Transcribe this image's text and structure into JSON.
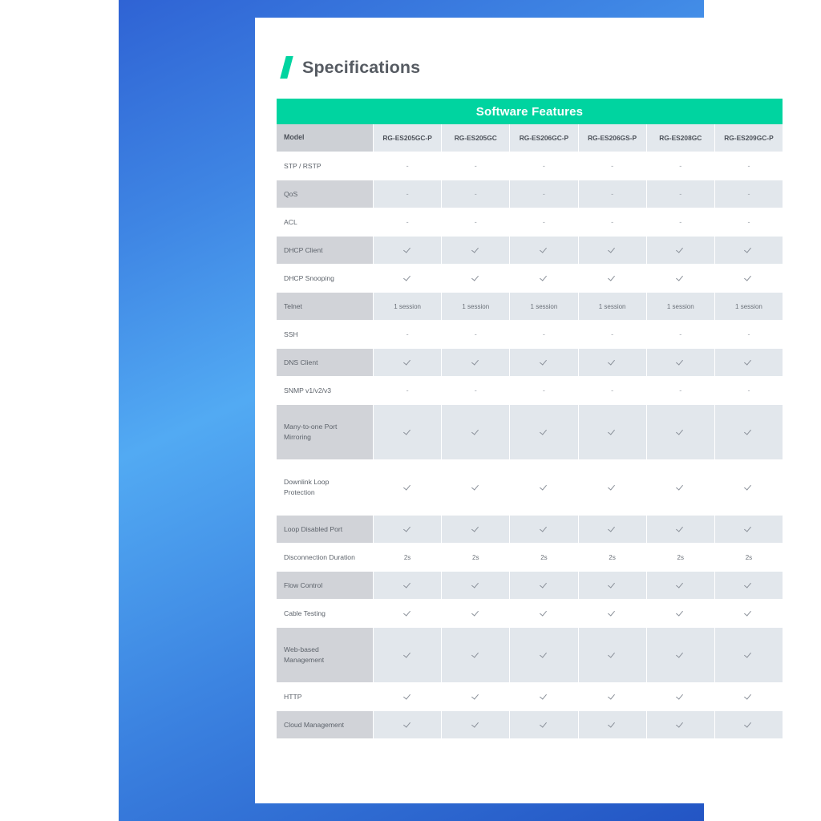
{
  "page": {
    "title": "Specifications",
    "slash_icon": "green-slash-icon",
    "accent_green": "#00d4a0",
    "frame_blue_start": "#2f63d4",
    "frame_blue_mid": "#52aaf3",
    "frame_blue_end": "#2355c4"
  },
  "table": {
    "band_title": "Software Features",
    "columns": [
      "Model",
      "RG-ES205GC-P",
      "RG-ES205GC",
      "RG-ES206GC-P",
      "RG-ES206GS-P",
      "RG-ES208GC",
      "RG-ES209GC-P"
    ],
    "rows": [
      {
        "label": "STP / RSTP",
        "lines": 1,
        "shaded": false,
        "values": [
          "-",
          "-",
          "-",
          "-",
          "-",
          "-"
        ]
      },
      {
        "label": "QoS",
        "lines": 1,
        "shaded": true,
        "values": [
          "-",
          "-",
          "-",
          "-",
          "-",
          "-"
        ]
      },
      {
        "label": "ACL",
        "lines": 1,
        "shaded": false,
        "values": [
          "-",
          "-",
          "-",
          "-",
          "-",
          "-"
        ]
      },
      {
        "label": "DHCP Client",
        "lines": 1,
        "shaded": true,
        "values": [
          "check",
          "check",
          "check",
          "check",
          "check",
          "check"
        ]
      },
      {
        "label": "DHCP Snooping",
        "lines": 1,
        "shaded": false,
        "values": [
          "check",
          "check",
          "check",
          "check",
          "check",
          "check"
        ]
      },
      {
        "label": "Telnet",
        "lines": 1,
        "shaded": true,
        "values": [
          "1 session",
          "1 session",
          "1 session",
          "1 session",
          "1 session",
          "1 session"
        ]
      },
      {
        "label": "SSH",
        "lines": 1,
        "shaded": false,
        "values": [
          "-",
          "-",
          "-",
          "-",
          "-",
          "-"
        ]
      },
      {
        "label": "DNS Client",
        "lines": 1,
        "shaded": true,
        "values": [
          "check",
          "check",
          "check",
          "check",
          "check",
          "check"
        ]
      },
      {
        "label": "SNMP v1/v2/v3",
        "lines": 1,
        "shaded": false,
        "values": [
          "-",
          "-",
          "-",
          "-",
          "-",
          "-"
        ]
      },
      {
        "label": "Many-to-one Port\nMirroring",
        "lines": 2,
        "shaded": true,
        "values": [
          "check",
          "check",
          "check",
          "check",
          "check",
          "check"
        ]
      },
      {
        "label": "Downlink Loop\nProtection",
        "lines": 2,
        "shaded": false,
        "values": [
          "check",
          "check",
          "check",
          "check",
          "check",
          "check"
        ]
      },
      {
        "label": "Loop Disabled Port",
        "lines": 1,
        "shaded": true,
        "values": [
          "check",
          "check",
          "check",
          "check",
          "check",
          "check"
        ]
      },
      {
        "label": "Disconnection Duration",
        "lines": 1,
        "shaded": false,
        "values": [
          "2s",
          "2s",
          "2s",
          "2s",
          "2s",
          "2s"
        ]
      },
      {
        "label": "Flow Control",
        "lines": 1,
        "shaded": true,
        "values": [
          "check",
          "check",
          "check",
          "check",
          "check",
          "check"
        ]
      },
      {
        "label": "Cable Testing",
        "lines": 1,
        "shaded": false,
        "values": [
          "check",
          "check",
          "check",
          "check",
          "check",
          "check"
        ]
      },
      {
        "label": "Web-based\nManagement",
        "lines": 2,
        "shaded": true,
        "values": [
          "check",
          "check",
          "check",
          "check",
          "check",
          "check"
        ]
      },
      {
        "label": "HTTP",
        "lines": 1,
        "shaded": false,
        "values": [
          "check",
          "check",
          "check",
          "check",
          "check",
          "check"
        ]
      },
      {
        "label": "Cloud Management",
        "lines": 1,
        "shaded": true,
        "values": [
          "check",
          "check",
          "check",
          "check",
          "check",
          "check"
        ]
      }
    ]
  }
}
